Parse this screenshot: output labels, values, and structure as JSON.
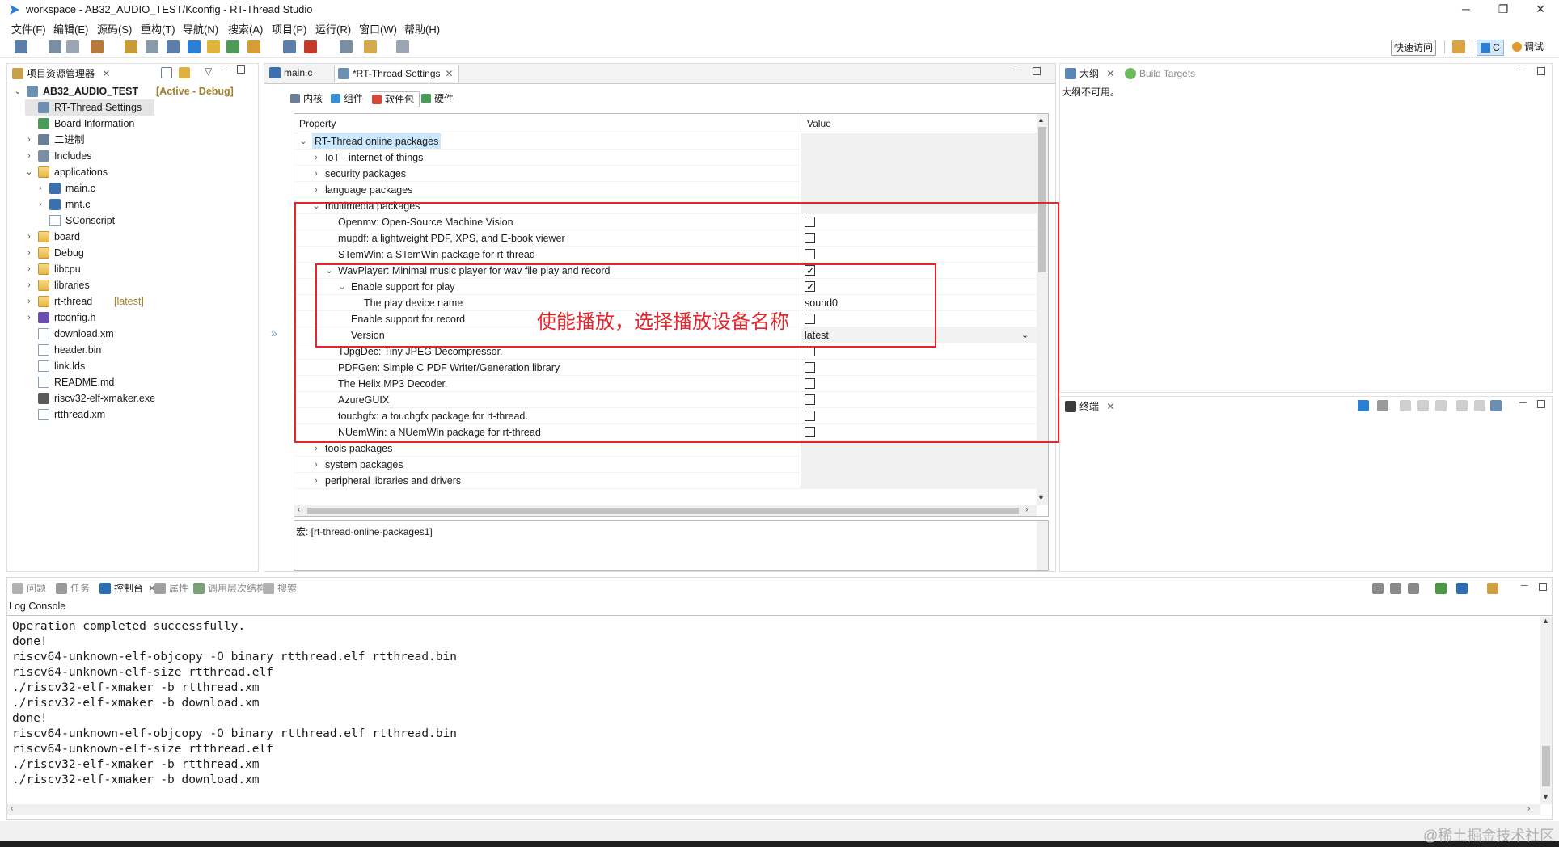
{
  "window": {
    "title": "workspace - AB32_AUDIO_TEST/Kconfig - RT-Thread Studio",
    "minimize": "─",
    "restore": "❐",
    "close": "✕"
  },
  "menu": [
    "文件(F)",
    "编辑(E)",
    "源码(S)",
    "重构(T)",
    "导航(N)",
    "搜索(A)",
    "项目(P)",
    "运行(R)",
    "窗口(W)",
    "帮助(H)"
  ],
  "toolbar": {
    "quick_access": "快速访问",
    "perspective_c": "C",
    "perspective_debug": "调试"
  },
  "project_explorer": {
    "title": "项目资源管理器",
    "project": "AB32_AUDIO_TEST",
    "project_state": "[Active - Debug]",
    "items": [
      {
        "label": "RT-Thread Settings",
        "depth": 1,
        "twisty": "",
        "kind": "rt"
      },
      {
        "label": "Board Information",
        "depth": 1,
        "twisty": "",
        "kind": "board"
      },
      {
        "label": "二进制",
        "depth": 1,
        "twisty": "›",
        "kind": "bin"
      },
      {
        "label": "Includes",
        "depth": 1,
        "twisty": "›",
        "kind": "inc"
      },
      {
        "label": "applications",
        "depth": 1,
        "twisty": "⌄",
        "kind": "folder"
      },
      {
        "label": "main.c",
        "depth": 2,
        "twisty": "›",
        "kind": "cfile"
      },
      {
        "label": "mnt.c",
        "depth": 2,
        "twisty": "›",
        "kind": "cfile"
      },
      {
        "label": "SConscript",
        "depth": 2,
        "twisty": "",
        "kind": "file"
      },
      {
        "label": "board",
        "depth": 1,
        "twisty": "›",
        "kind": "folder"
      },
      {
        "label": "Debug",
        "depth": 1,
        "twisty": "›",
        "kind": "folder"
      },
      {
        "label": "libcpu",
        "depth": 1,
        "twisty": "›",
        "kind": "folder"
      },
      {
        "label": "libraries",
        "depth": 1,
        "twisty": "›",
        "kind": "folder"
      },
      {
        "label": "rt-thread",
        "depth": 1,
        "twisty": "›",
        "kind": "folder",
        "suffix": "[latest]"
      },
      {
        "label": "rtconfig.h",
        "depth": 1,
        "twisty": "›",
        "kind": "hfile"
      },
      {
        "label": "download.xm",
        "depth": 1,
        "twisty": "",
        "kind": "file"
      },
      {
        "label": "header.bin",
        "depth": 1,
        "twisty": "",
        "kind": "file"
      },
      {
        "label": "link.lds",
        "depth": 1,
        "twisty": "",
        "kind": "file"
      },
      {
        "label": "README.md",
        "depth": 1,
        "twisty": "",
        "kind": "file"
      },
      {
        "label": "riscv32-elf-xmaker.exe",
        "depth": 1,
        "twisty": "",
        "kind": "exe"
      },
      {
        "label": "rtthread.xm",
        "depth": 1,
        "twisty": "",
        "kind": "file"
      }
    ]
  },
  "editor": {
    "tabs": [
      {
        "label": "main.c",
        "active": false
      },
      {
        "label": "*RT-Thread Settings",
        "active": true
      }
    ],
    "subtabs": [
      "内核",
      "组件",
      "软件包",
      "硬件"
    ],
    "table": {
      "col_property": "Property",
      "col_value": "Value",
      "rows": [
        {
          "label": "RT-Thread online packages",
          "indent": 0,
          "twisty": "⌄",
          "value": "",
          "check": null,
          "gray": true,
          "selected": true
        },
        {
          "label": "IoT - internet of things",
          "indent": 1,
          "twisty": "›",
          "value": "",
          "check": null,
          "gray": true
        },
        {
          "label": "security packages",
          "indent": 1,
          "twisty": "›",
          "value": "",
          "check": null,
          "gray": true
        },
        {
          "label": "language packages",
          "indent": 1,
          "twisty": "›",
          "value": "",
          "check": null,
          "gray": true
        },
        {
          "label": "multimedia packages",
          "indent": 1,
          "twisty": "⌄",
          "value": "",
          "check": null,
          "gray": true
        },
        {
          "label": "Openmv: Open-Source Machine Vision",
          "indent": 2,
          "twisty": "",
          "value": "",
          "check": false
        },
        {
          "label": "mupdf: a lightweight PDF, XPS, and E-book viewer",
          "indent": 2,
          "twisty": "",
          "value": "",
          "check": false
        },
        {
          "label": "STemWin: a STemWin package for rt-thread",
          "indent": 2,
          "twisty": "",
          "value": "",
          "check": false
        },
        {
          "label": "WavPlayer: Minimal music player for wav file play and record",
          "indent": 2,
          "twisty": "⌄",
          "value": "",
          "check": true
        },
        {
          "label": "Enable support for play",
          "indent": 3,
          "twisty": "⌄",
          "value": "",
          "check": true
        },
        {
          "label": "The play device name",
          "indent": 4,
          "twisty": "",
          "value": "sound0",
          "check": null
        },
        {
          "label": "Enable support for record",
          "indent": 3,
          "twisty": "",
          "value": "",
          "check": false
        },
        {
          "label": "Version",
          "indent": 3,
          "twisty": "",
          "value": "latest",
          "check": null,
          "dropdown": true
        },
        {
          "label": "TJpgDec: Tiny JPEG Decompressor.",
          "indent": 2,
          "twisty": "",
          "value": "",
          "check": false
        },
        {
          "label": "PDFGen: Simple C PDF Writer/Generation library",
          "indent": 2,
          "twisty": "",
          "value": "",
          "check": false
        },
        {
          "label": "The Helix MP3 Decoder.",
          "indent": 2,
          "twisty": "",
          "value": "",
          "check": false
        },
        {
          "label": "AzureGUIX",
          "indent": 2,
          "twisty": "",
          "value": "",
          "check": false
        },
        {
          "label": "touchgfx: a touchgfx package for rt-thread.",
          "indent": 2,
          "twisty": "",
          "value": "",
          "check": false
        },
        {
          "label": "NUemWin: a NUemWin package for rt-thread",
          "indent": 2,
          "twisty": "",
          "value": "",
          "check": false
        },
        {
          "label": "tools packages",
          "indent": 1,
          "twisty": "›",
          "value": "",
          "check": null,
          "gray": true
        },
        {
          "label": "system packages",
          "indent": 1,
          "twisty": "›",
          "value": "",
          "check": null,
          "gray": true
        },
        {
          "label": "peripheral libraries and drivers",
          "indent": 1,
          "twisty": "›",
          "value": "",
          "check": null,
          "gray": true
        }
      ]
    },
    "macro_text": "宏: [rt-thread-online-packages1]",
    "annotation": "使能播放，选择播放设备名称",
    "collapse_arrow": "»"
  },
  "outline": {
    "tab1": "大纲",
    "tab2": "Build Targets",
    "message": "大纲不可用。"
  },
  "terminal": {
    "tab": "终端"
  },
  "bottom": {
    "tabs": [
      "问题",
      "任务",
      "控制台",
      "属性",
      "调用层次结构",
      "搜索"
    ],
    "console_title": "Log Console",
    "lines": [
      "Operation completed successfully.",
      "done!",
      "riscv64-unknown-elf-objcopy -O binary rtthread.elf rtthread.bin",
      "riscv64-unknown-elf-size rtthread.elf",
      "./riscv32-elf-xmaker -b rtthread.xm",
      "./riscv32-elf-xmaker -b download.xm",
      "done!",
      "riscv64-unknown-elf-objcopy -O binary rtthread.elf rtthread.bin",
      "riscv64-unknown-elf-size rtthread.elf",
      "./riscv32-elf-xmaker -b rtthread.xm",
      "./riscv32-elf-xmaker -b download.xm"
    ]
  },
  "watermark": "@稀土掘金技术社区",
  "colors": {
    "accent": "#0078d7",
    "annotation_red": "#e2262b",
    "selection": "#cce8ff",
    "gray_cell": "#f0f0f0"
  }
}
